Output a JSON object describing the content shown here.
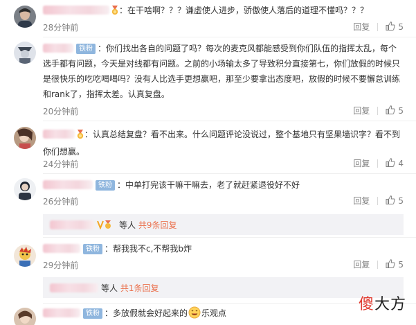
{
  "comments": [
    {
      "text": "在干啥啊？？？谦虚使人进步，骄傲使人落后的道理不懂吗？？？",
      "badge": "",
      "time": "28分钟前",
      "reply": "回复",
      "likes": "5"
    },
    {
      "badge": "铁粉",
      "lines": [
        "你们找出各自的问题了吗？每次的麦克风都能感受到你们队伍的指挥太乱，每个",
        "选手都有问题，今天是对线都有问题。之前的小场输太多了导致积分直接第七，你们放假的时候只",
        "是很快乐的吃吃喝喝吗？没有人比选手更想赢吧，那至少要拿出态度吧，放假的时候不要懈怠训练",
        "和rank了，指挥太差。认真复盘。"
      ],
      "time": "20分钟前",
      "reply": "回复",
      "likes": "5"
    },
    {
      "badge": "",
      "lines": [
        "认真总结复盘？看不出来。什么问题评论没说过，整个基地只有坚果墙识字？看不到",
        "你们想赢。"
      ],
      "time": "24分钟前",
      "reply": "回复",
      "likes": "4"
    },
    {
      "badge": "铁粉",
      "text": "中单打完该干嘛干嘛去，老了就赶紧退役好不好",
      "time": "26分钟前",
      "reply": "回复",
      "likes": "5",
      "sub": {
        "prefix": "等人",
        "link": "共9条回复"
      }
    },
    {
      "badge": "铁粉",
      "text": "帮我我不c,不帮我b炸",
      "time": "29分钟前",
      "reply": "回复",
      "likes": "5",
      "sub": {
        "prefix": "等人",
        "link": "共1条回复"
      }
    },
    {
      "badge": "铁粉",
      "text_before": "多放假就会好起来的",
      "text_after": "乐观点",
      "emoji": "smile-emoji"
    }
  ],
  "watermark": {
    "part1": "傻",
    "part2": "大方"
  },
  "colors": {
    "badge": "#8fb6de",
    "link": "#eb7350",
    "muted": "#808080",
    "watermark_red": "#e03a2f"
  }
}
